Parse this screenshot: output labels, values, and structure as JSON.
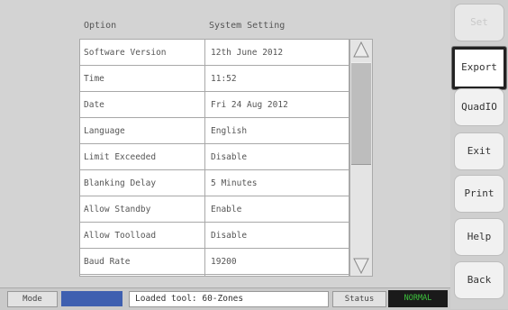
{
  "header": {
    "option_label": "Option",
    "setting_label": "System Setting"
  },
  "table": {
    "rows": [
      {
        "option": "Software Version",
        "value": "12th June 2012"
      },
      {
        "option": "Time",
        "value": "11:52"
      },
      {
        "option": "Date",
        "value": "Fri 24 Aug 2012"
      },
      {
        "option": "Language",
        "value": "English"
      },
      {
        "option": "Limit Exceeded",
        "value": "Disable"
      },
      {
        "option": "Blanking Delay",
        "value": "5 Minutes"
      },
      {
        "option": "Allow Standby",
        "value": "Enable"
      },
      {
        "option": "Allow Toolload",
        "value": "Disable"
      },
      {
        "option": "Baud Rate",
        "value": "19200"
      }
    ]
  },
  "sidebar": {
    "buttons": [
      {
        "label": "Set",
        "state": "disabled"
      },
      {
        "label": "Export",
        "state": "selected"
      },
      {
        "label": "QuadIO",
        "state": "normal"
      },
      {
        "label": "Exit",
        "state": "normal"
      },
      {
        "label": "Print",
        "state": "normal"
      },
      {
        "label": "Help",
        "state": "normal"
      },
      {
        "label": "Back",
        "state": "normal"
      }
    ]
  },
  "status_bar": {
    "mode_label": "Mode",
    "mode_color": "#3e5fb0",
    "message": "Loaded tool: 60-Zones",
    "status_label": "Status",
    "status_value": "NORMAL",
    "status_color": "#3ec43e"
  }
}
